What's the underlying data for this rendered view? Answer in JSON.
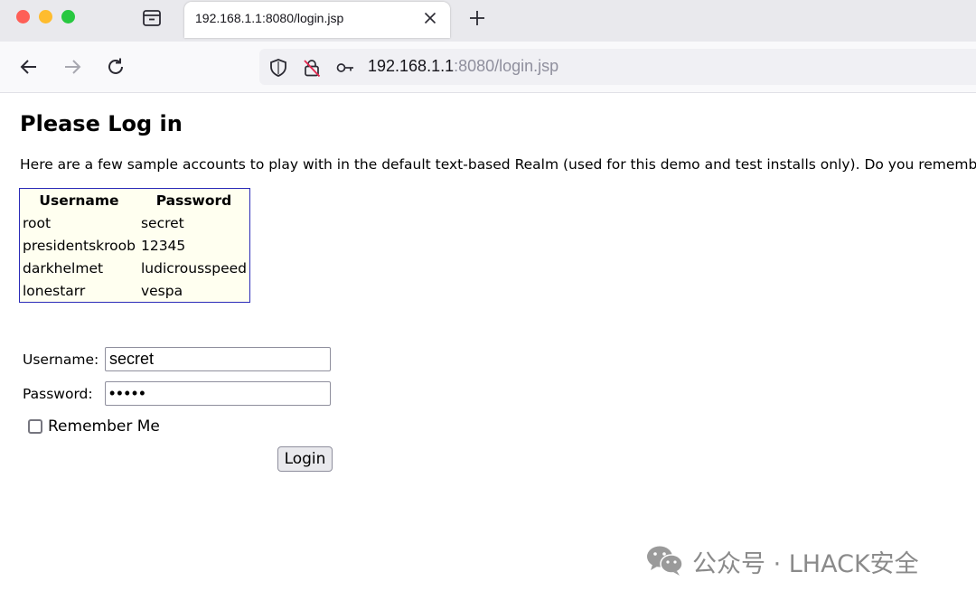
{
  "browser": {
    "tab_title": "192.168.1.1:8080/login.jsp",
    "url_host": "192.168.1.1",
    "url_rest": ":8080/login.jsp"
  },
  "page": {
    "heading": "Please Log in",
    "intro": "Here are a few sample accounts to play with in the default text-based Realm (used for this demo and test installs only). Do you remembe",
    "accounts_table": {
      "headers": [
        "Username",
        "Password"
      ],
      "rows": [
        [
          "root",
          "secret"
        ],
        [
          "presidentskroob",
          "12345"
        ],
        [
          "darkhelmet",
          "ludicrousspeed"
        ],
        [
          "lonestarr",
          "vespa"
        ]
      ]
    },
    "form": {
      "username_label": "Username:",
      "username_value": "secret",
      "password_label": "Password:",
      "password_value": "•••••",
      "remember_label": "Remember Me",
      "remember_checked": false,
      "login_label": "Login"
    }
  },
  "watermark": {
    "text": "公众号 · LHACK安全",
    "icon": "wechat-icon"
  },
  "colors": {
    "table_border": "#2a2ab8",
    "table_bg": "#fffff0",
    "url_rest": "#8f8f9d"
  }
}
